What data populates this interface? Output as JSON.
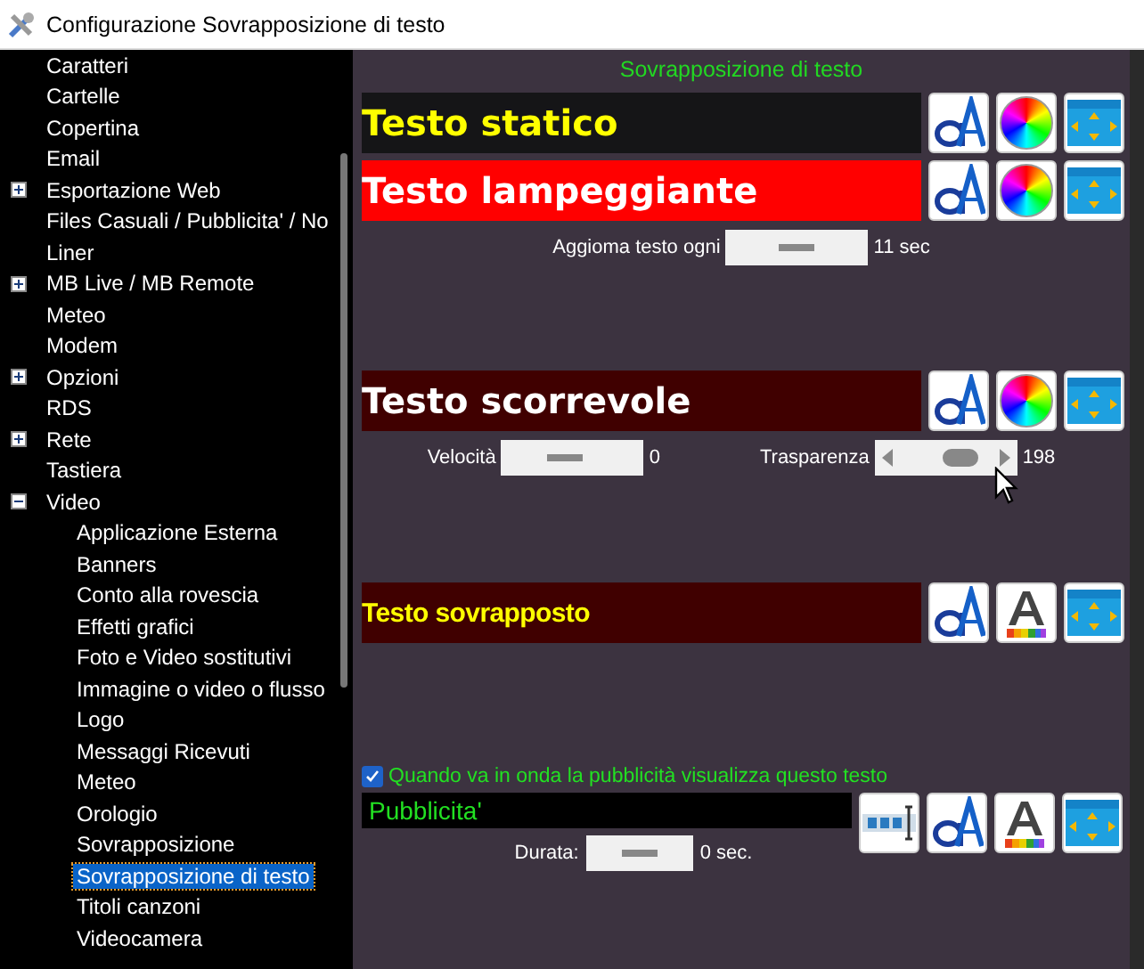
{
  "window": {
    "title": "Configurazione Sovrapposizione di testo"
  },
  "sidebar": {
    "items": [
      {
        "label": "Caratteri",
        "kind": "leaf",
        "selected": false
      },
      {
        "label": "Cartelle",
        "kind": "leaf",
        "selected": false
      },
      {
        "label": "Copertina",
        "kind": "leaf",
        "selected": false
      },
      {
        "label": "Email",
        "kind": "leaf",
        "selected": false
      },
      {
        "label": "Esportazione Web",
        "kind": "node",
        "expanded": false,
        "selected": false
      },
      {
        "label": "Files Casuali / Pubblicita' / No",
        "kind": "leaf",
        "selected": false
      },
      {
        "label": "Liner",
        "kind": "leaf",
        "selected": false
      },
      {
        "label": "MB Live / MB Remote",
        "kind": "node",
        "expanded": false,
        "selected": false
      },
      {
        "label": "Meteo",
        "kind": "leaf",
        "selected": false
      },
      {
        "label": "Modem",
        "kind": "leaf",
        "selected": false
      },
      {
        "label": "Opzioni",
        "kind": "node",
        "expanded": false,
        "selected": false
      },
      {
        "label": "RDS",
        "kind": "leaf",
        "selected": false
      },
      {
        "label": "Rete",
        "kind": "node",
        "expanded": false,
        "selected": false
      },
      {
        "label": "Tastiera",
        "kind": "leaf",
        "selected": false
      },
      {
        "label": "Video",
        "kind": "node",
        "expanded": true,
        "selected": false,
        "children": [
          {
            "label": "Applicazione Esterna",
            "selected": false
          },
          {
            "label": "Banners",
            "selected": false
          },
          {
            "label": "Conto alla rovescia",
            "selected": false
          },
          {
            "label": "Effetti grafici",
            "selected": false
          },
          {
            "label": "Foto e Video sostitutivi",
            "selected": false
          },
          {
            "label": "Immagine o video o flusso",
            "selected": false
          },
          {
            "label": "Logo",
            "selected": false
          },
          {
            "label": "Messaggi Ricevuti",
            "selected": false
          },
          {
            "label": "Meteo",
            "selected": false
          },
          {
            "label": "Orologio",
            "selected": false
          },
          {
            "label": "Sovrapposizione",
            "selected": false
          },
          {
            "label": "Sovrapposizione di testo",
            "selected": true
          },
          {
            "label": "Titoli canzoni",
            "selected": false
          },
          {
            "label": "Videocamera",
            "selected": false
          }
        ]
      }
    ]
  },
  "panel": {
    "heading": "Sovrapposizione di testo",
    "sections": [
      {
        "text": "Testo statico",
        "kind": "static",
        "color": "#151517",
        "buttons": [
          {
            "kind": "font"
          },
          {
            "kind": "color"
          },
          {
            "kind": "position"
          }
        ]
      },
      {
        "text": "Testo lampeggiante",
        "kind": "blinking",
        "color": "#ff0000",
        "buttons": [
          {
            "kind": "font"
          },
          {
            "kind": "color"
          },
          {
            "kind": "position"
          }
        ],
        "controls": [
          {
            "label": "Aggioma testo ogni",
            "kind": "slider",
            "level": 0.5,
            "reading": "11 sec"
          }
        ]
      },
      {
        "text": "Testo scorrevole",
        "kind": "scrolling",
        "color": "#400000",
        "buttons": [
          {
            "kind": "font"
          },
          {
            "kind": "color"
          },
          {
            "kind": "position"
          }
        ],
        "controls": [
          {
            "label": "Velocità",
            "kind": "slider",
            "level": 0.45,
            "reading": "0"
          },
          {
            "label": "Trasparenza",
            "kind": "scrollbar",
            "level": 0.6,
            "reading": "198"
          }
        ]
      },
      {
        "text": "Testo sovrapposto",
        "kind": "overlay",
        "color": "#400000",
        "buttons": [
          {
            "kind": "font"
          },
          {
            "kind": "palette"
          },
          {
            "kind": "position"
          }
        ]
      }
    ],
    "ad": {
      "checkbox": {
        "label": "Quando va in onda la pubblicità visualizza questo testo",
        "checked": true
      },
      "value": "Pubblicita'",
      "buttons": [
        {
          "kind": "text"
        },
        {
          "kind": "font"
        },
        {
          "kind": "palette"
        },
        {
          "kind": "position"
        }
      ],
      "duration": {
        "label": "Durata:",
        "level": 0.5,
        "reading": "0 sec."
      }
    }
  }
}
